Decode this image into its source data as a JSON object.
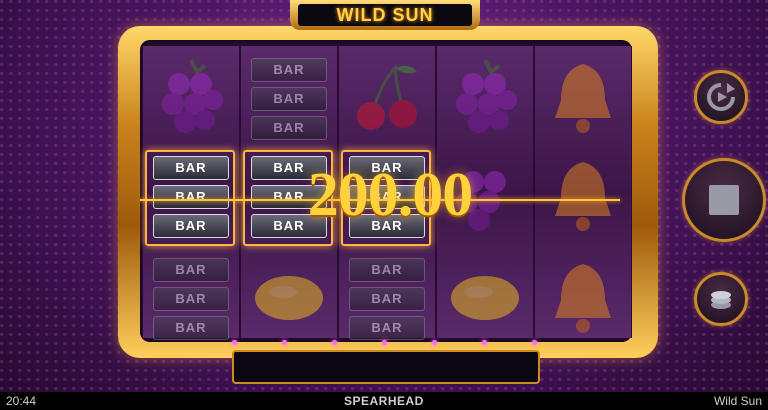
{
  "game": {
    "title": "WILD SUN",
    "win_amount": "200.00"
  },
  "reels": [
    {
      "symbols": [
        "grapes",
        "bar",
        "bar"
      ],
      "highlighted_row": 1
    },
    {
      "symbols": [
        "bar",
        "bar",
        "lemon"
      ],
      "highlighted_row": 1
    },
    {
      "symbols": [
        "cherries",
        "bar",
        "bar"
      ],
      "highlighted_row": 1
    },
    {
      "symbols": [
        "grapes",
        "grapes",
        "lemon"
      ],
      "highlighted_row": null
    },
    {
      "symbols": [
        "bell",
        "bell",
        "bell"
      ],
      "highlighted_row": null
    }
  ],
  "bar_label": "BAR",
  "controls": {
    "autoplay_icon": "autoplay-icon",
    "spin_icon": "stop-icon",
    "bet_icon": "coin-stack-icon"
  },
  "footer": {
    "time": "20:44",
    "brand": "SPEARHEAD",
    "game_name": "Wild Sun"
  },
  "colors": {
    "gold": "#ffb640",
    "win_text": "#ffd23c",
    "background": "#4b1663"
  }
}
